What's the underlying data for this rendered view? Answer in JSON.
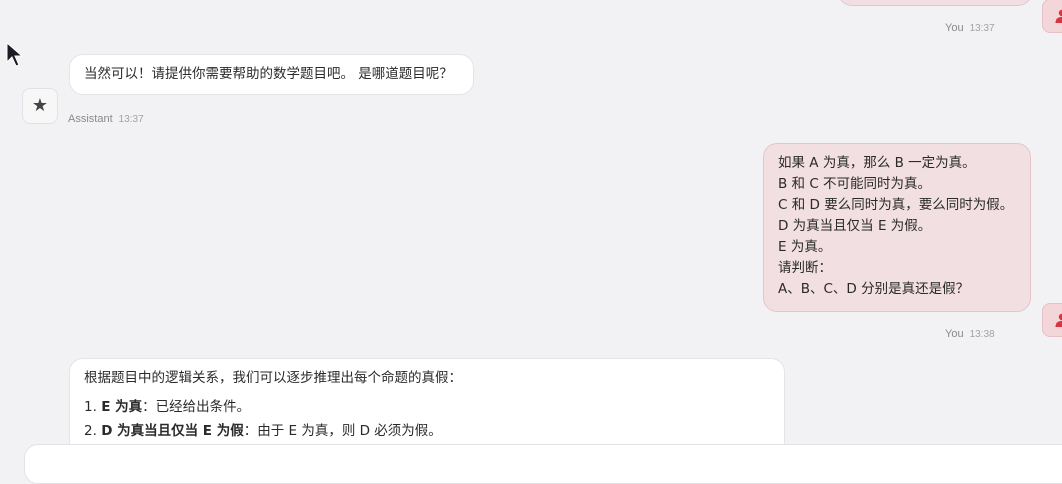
{
  "messages": {
    "user_1": {
      "sender": "You",
      "time": "13:37"
    },
    "assistant_1": {
      "text": "当然可以！请提供你需要帮助的数学题目吧。 是哪道题目呢？",
      "sender": "Assistant",
      "time": "13:37",
      "avatar_icon": "★"
    },
    "user_2": {
      "lines": [
        "如果 A 为真，那么 B 一定为真。",
        "B 和 C 不可能同时为真。",
        "C 和 D 要么同时为真，要么同时为假。",
        "D 为真当且仅当 E 为假。",
        "E 为真。",
        "请判断：",
        "A、B、C、D 分别是真还是假？"
      ],
      "sender": "You",
      "time": "13:38"
    },
    "assistant_2": {
      "intro": "根据题目中的逻辑关系，我们可以逐步推理出每个命题的真假：",
      "steps": [
        {
          "num": "1.",
          "bold": "E 为真",
          "rest": "：已经给出条件。"
        },
        {
          "num": "2.",
          "bold": "D 为真当且仅当 E 为假",
          "rest": "：由于 E 为真，则 D 必须为假。"
        }
      ]
    }
  },
  "icons": {
    "user_avatar": "user-icon",
    "assistant_avatar": "star-icon",
    "cursor": "mouse-pointer-icon"
  },
  "colors": {
    "background": "#f2f2f4",
    "user_bubble": "#f1dfe1",
    "user_bubble_border": "#e6c5c9",
    "user_icon": "#d9343f",
    "assistant_bubble": "#ffffff"
  }
}
